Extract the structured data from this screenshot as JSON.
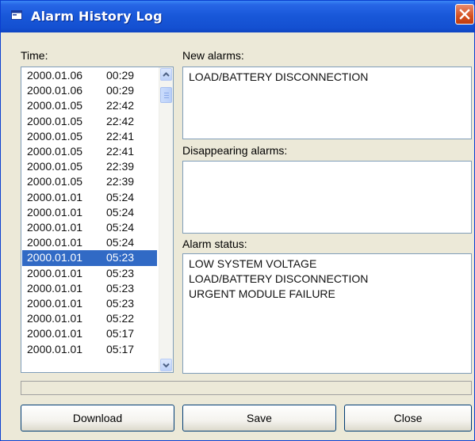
{
  "window": {
    "title": "Alarm History Log",
    "close_glyph": "close-icon"
  },
  "time_list": {
    "label": "Time:",
    "selected_index": 12,
    "items": [
      {
        "date": "2000.01.06",
        "time": "00:29"
      },
      {
        "date": "2000.01.06",
        "time": "00:29"
      },
      {
        "date": "2000.01.05",
        "time": "22:42"
      },
      {
        "date": "2000.01.05",
        "time": "22:42"
      },
      {
        "date": "2000.01.05",
        "time": "22:41"
      },
      {
        "date": "2000.01.05",
        "time": "22:41"
      },
      {
        "date": "2000.01.05",
        "time": "22:39"
      },
      {
        "date": "2000.01.05",
        "time": "22:39"
      },
      {
        "date": "2000.01.01",
        "time": "05:24"
      },
      {
        "date": "2000.01.01",
        "time": "05:24"
      },
      {
        "date": "2000.01.01",
        "time": "05:24"
      },
      {
        "date": "2000.01.01",
        "time": "05:24"
      },
      {
        "date": "2000.01.01",
        "time": "05:23"
      },
      {
        "date": "2000.01.01",
        "time": "05:23"
      },
      {
        "date": "2000.01.01",
        "time": "05:23"
      },
      {
        "date": "2000.01.01",
        "time": "05:23"
      },
      {
        "date": "2000.01.01",
        "time": "05:22"
      },
      {
        "date": "2000.01.01",
        "time": "05:17"
      },
      {
        "date": "2000.01.01",
        "time": "05:17"
      }
    ]
  },
  "new_alarms": {
    "label": "New alarms:",
    "lines": [
      "LOAD/BATTERY DISCONNECTION"
    ]
  },
  "disappearing_alarms": {
    "label": "Disappearing alarms:",
    "lines": []
  },
  "alarm_status": {
    "label": "Alarm status:",
    "lines": [
      "LOW SYSTEM VOLTAGE",
      "LOAD/BATTERY DISCONNECTION",
      "URGENT MODULE FAILURE"
    ]
  },
  "buttons": {
    "download": "Download",
    "save": "Save",
    "close": "Close"
  },
  "colors": {
    "titlebar": "#1857d8",
    "selection": "#316ac5",
    "window_bg": "#ece9d8",
    "close_button": "#d4501f"
  }
}
